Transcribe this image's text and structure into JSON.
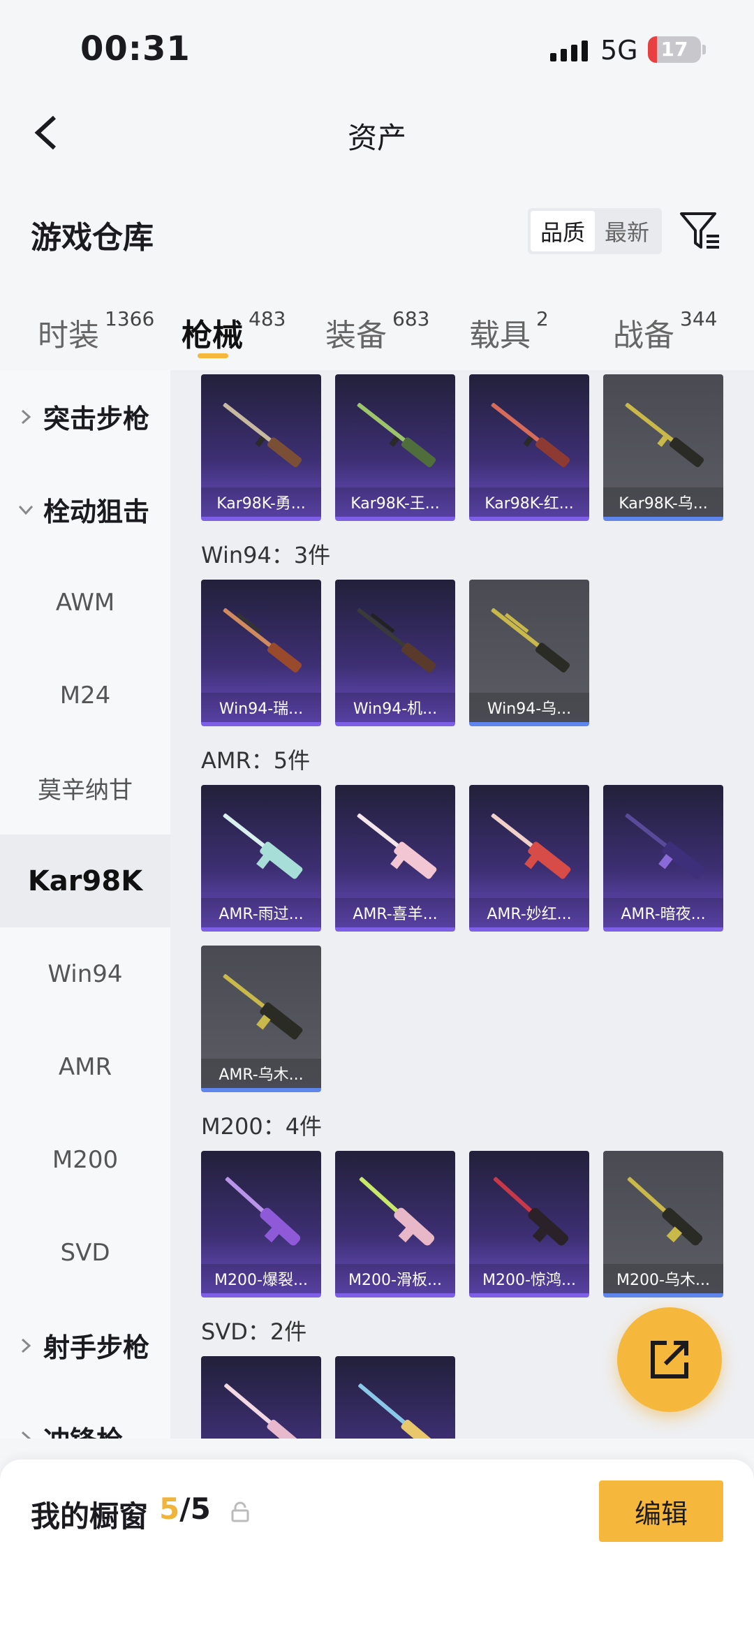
{
  "status_bar": {
    "time": "00:31",
    "network": "5G",
    "battery": "17",
    "battery_color": "#e84040"
  },
  "nav": {
    "title": "资产"
  },
  "section": {
    "title": "游戏仓库",
    "sort_options": [
      "品质",
      "最新"
    ]
  },
  "tabs": [
    {
      "label": "时装",
      "count": "1366"
    },
    {
      "label": "枪械",
      "count": "483"
    },
    {
      "label": "装备",
      "count": "683"
    },
    {
      "label": "载具",
      "count": "2"
    },
    {
      "label": "战备",
      "count": "344"
    }
  ],
  "sidebar": {
    "items": [
      {
        "label": "突击步枪"
      },
      {
        "label": "栓动狙击"
      },
      {
        "label": "AWM"
      },
      {
        "label": "M24"
      },
      {
        "label": "莫辛纳甘"
      },
      {
        "label": "Kar98K"
      },
      {
        "label": "Win94"
      },
      {
        "label": "AMR"
      },
      {
        "label": "M200"
      },
      {
        "label": "SVD"
      },
      {
        "label": "射手步枪"
      },
      {
        "label": "冲锋枪"
      }
    ]
  },
  "categories": [
    {
      "label": "Win94：3件"
    },
    {
      "label": "AMR：5件"
    },
    {
      "label": "M200：4件"
    },
    {
      "label": "SVD：2件"
    }
  ],
  "items": {
    "kar98k": [
      "Kar98K-勇...",
      "Kar98K-王...",
      "Kar98K-红...",
      "Kar98K-乌..."
    ],
    "win94": [
      "Win94-瑞...",
      "Win94-机...",
      "Win94-乌..."
    ],
    "amr": [
      "AMR-雨过...",
      "AMR-喜羊...",
      "AMR-妙红...",
      "AMR-暗夜...",
      "AMR-乌木..."
    ],
    "m200": [
      "M200-爆裂...",
      "M200-滑板...",
      "M200-惊鸿...",
      "M200-乌木..."
    ]
  },
  "bottom": {
    "label": "我的橱窗",
    "current": "5",
    "total": "/5",
    "edit_label": "编辑"
  },
  "colors": {
    "accent": "#f5b83c",
    "epic_card": "#3d2f73",
    "legendary_card": "#5b5c64"
  }
}
